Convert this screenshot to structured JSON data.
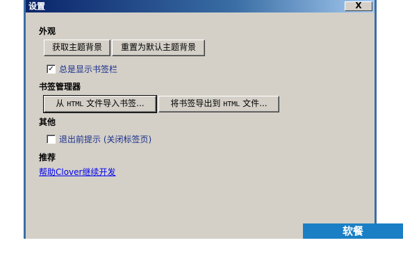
{
  "window": {
    "title": "设置",
    "close_label": "X"
  },
  "appearance": {
    "section_title": "外观",
    "get_theme_bg_label": "获取主题背景",
    "reset_theme_bg_label": "重置为默认主题背景",
    "show_bookmarks_bar": {
      "checked": true,
      "label": "总是显示书签栏"
    }
  },
  "bookmark_manager": {
    "section_title": "书签管理器",
    "import_prefix": "从 ",
    "import_mono": "HTML",
    "import_suffix": " 文件导入书签...",
    "export_prefix": "将书签导出到 ",
    "export_mono": "HTML",
    "export_suffix": " 文件..."
  },
  "other": {
    "section_title": "其他",
    "prompt_before_exit": {
      "checked": false,
      "label": "退出前提示 (关闭标签页)"
    }
  },
  "recommend": {
    "section_title": "推荐",
    "help_link": "帮助Clover继续开发"
  },
  "watermark": {
    "text": "软餐 ruancan.com"
  }
}
